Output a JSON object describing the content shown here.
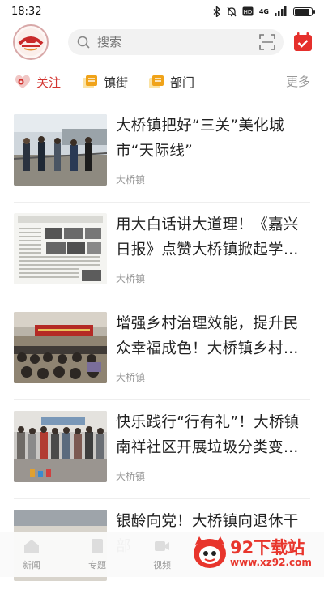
{
  "status_bar": {
    "time": "18:32",
    "network": "4G",
    "battery_level": 0.9
  },
  "header": {
    "search_placeholder": "搜索"
  },
  "tabs": [
    {
      "label": "关注",
      "active": true
    },
    {
      "label": "镇街",
      "active": false
    },
    {
      "label": "部门",
      "active": false
    }
  ],
  "more_label": "更多",
  "news": [
    {
      "title": "大桥镇把好“三关”美化城市“天际线”",
      "source": "大桥镇"
    },
    {
      "title": "用大白话讲大道理！《嘉兴日报》点赞大桥镇掀起学习宣传贯彻热潮",
      "source": "大桥镇"
    },
    {
      "title": "增强乡村治理效能，提升民众幸福成色！大桥镇乡村治理工作推进会召开",
      "source": "大桥镇"
    },
    {
      "title": "快乐践行“行有礼”！大桥镇南祥社区开展垃圾分类变废为宝活动",
      "source": "大桥镇"
    },
    {
      "title": "银龄向党！大桥镇向退休干部",
      "source": "大桥镇"
    }
  ],
  "bottom_nav": [
    {
      "label": "新闻"
    },
    {
      "label": "专题"
    },
    {
      "label": "视频"
    }
  ],
  "watermark": {
    "title": "92下载站",
    "url": "www.xz92.com"
  },
  "colors": {
    "accent": "#d2332f",
    "tab_icon": "#f0a319"
  }
}
